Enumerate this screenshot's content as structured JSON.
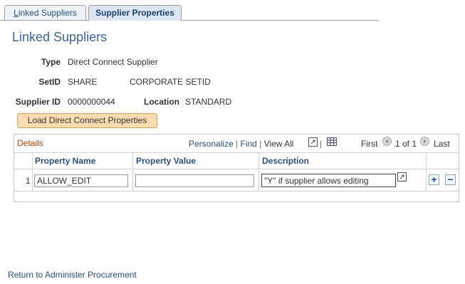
{
  "tabs": [
    {
      "label_underlined": "L",
      "label_rest": "inked Suppliers"
    },
    {
      "label": "Supplier Properties"
    }
  ],
  "page_title": "Linked Suppliers",
  "fields": {
    "type": {
      "label": "Type",
      "value": "Direct Connect Supplier"
    },
    "setid": {
      "label": "SetID",
      "value": "SHARE",
      "description": "CORPORATE SETID"
    },
    "supplier_id": {
      "label": "Supplier ID",
      "value": "0000000044"
    },
    "location": {
      "label": "Location",
      "value": "STANDARD"
    }
  },
  "load_button": "Load Direct Connect Properties",
  "grid": {
    "title": "Details",
    "personalize": "Personalize",
    "find": "Find",
    "view_all": "View All",
    "sep": "|",
    "first": "First",
    "range": "1 of 1",
    "last": "Last",
    "columns": [
      "Property Name",
      "Property Value",
      "Description"
    ],
    "rows": [
      {
        "num": "1",
        "property_name": "ALLOW_EDIT",
        "property_value": "",
        "description": "\"Y\" if supplier allows editing"
      }
    ]
  },
  "footer_link": "Return to Administer Procurement",
  "icons": [
    "zoom-icon",
    "spreadsheet-icon",
    "first-arrow-icon",
    "next-arrow-icon",
    "add-row-icon",
    "delete-row-icon"
  ]
}
